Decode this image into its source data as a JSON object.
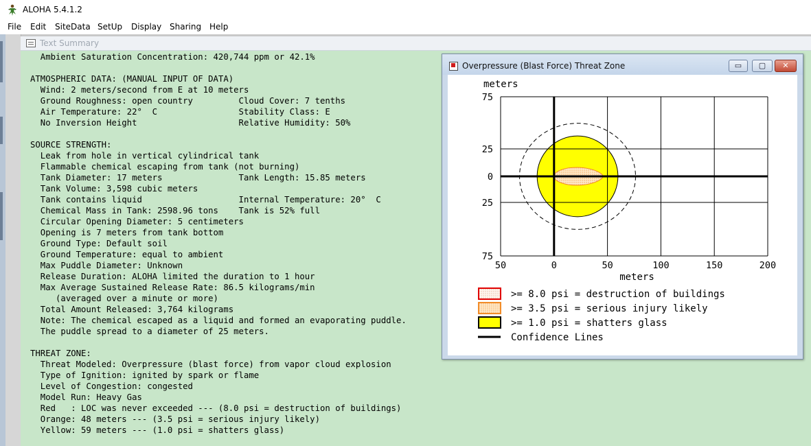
{
  "app": {
    "title": "ALOHA 5.4.1.2"
  },
  "menu": [
    "File",
    "Edit",
    "SiteData",
    "SetUp",
    "Display",
    "Sharing",
    "Help"
  ],
  "text_summary": {
    "title": "Text Summary",
    "lines": [
      "  Ambient Saturation Concentration: 420,744 ppm or 42.1%",
      "",
      "ATMOSPHERIC DATA: (MANUAL INPUT OF DATA)",
      "  Wind: 2 meters/second from E at 10 meters",
      "  Ground Roughness: open country         Cloud Cover: 7 tenths",
      "  Air Temperature: 22°  C                Stability Class: E",
      "  No Inversion Height                    Relative Humidity: 50%",
      "",
      "SOURCE STRENGTH:",
      "  Leak from hole in vertical cylindrical tank",
      "  Flammable chemical escaping from tank (not burning)",
      "  Tank Diameter: 17 meters               Tank Length: 15.85 meters",
      "  Tank Volume: 3,598 cubic meters",
      "  Tank contains liquid                   Internal Temperature: 20°  C",
      "  Chemical Mass in Tank: 2598.96 tons    Tank is 52% full",
      "  Circular Opening Diameter: 5 centimeters",
      "  Opening is 7 meters from tank bottom",
      "  Ground Type: Default soil",
      "  Ground Temperature: equal to ambient",
      "  Max Puddle Diameter: Unknown",
      "  Release Duration: ALOHA limited the duration to 1 hour",
      "  Max Average Sustained Release Rate: 86.5 kilograms/min",
      "     (averaged over a minute or more)",
      "  Total Amount Released: 3,764 kilograms",
      "  Note: The chemical escaped as a liquid and formed an evaporating puddle.",
      "  The puddle spread to a diameter of 25 meters.",
      "",
      "THREAT ZONE:",
      "  Threat Modeled: Overpressure (blast force) from vapor cloud explosion",
      "  Type of Ignition: ignited by spark or flame",
      "  Level of Congestion: congested",
      "  Model Run: Heavy Gas",
      "  Red   : LOC was never exceeded --- (8.0 psi = destruction of buildings)",
      "  Orange: 48 meters --- (3.5 psi = serious injury likely)",
      "  Yellow: 59 meters --- (1.0 psi = shatters glass)"
    ]
  },
  "threat_window": {
    "title": "Overpressure (Blast Force) Threat Zone",
    "buttons": {
      "minimize": "▭",
      "maximize": "▢",
      "close": "✕"
    }
  },
  "chart_data": {
    "type": "area",
    "y_unit_label": "meters",
    "xlabel": "meters",
    "x_ticks": [
      "50",
      "0",
      "50",
      "100",
      "150",
      "200"
    ],
    "y_ticks": [
      "75",
      "25",
      "0",
      "25",
      "75"
    ],
    "xlim": [
      -50,
      200
    ],
    "ylim": [
      -75,
      75
    ],
    "grid": true,
    "source_point": {
      "x": 0,
      "y": 0
    },
    "zones": [
      {
        "name": "yellow",
        "level_psi": 1.0,
        "distance_m": 59,
        "color": "#ffff00",
        "outline": "#000000",
        "legend": ">= 1.0 psi = shatters glass"
      },
      {
        "name": "orange",
        "level_psi": 3.5,
        "distance_m": 48,
        "color": "#ffdca8",
        "outline": "#f28c28",
        "legend": ">= 3.5 psi = serious injury likely"
      },
      {
        "name": "red",
        "level_psi": 8.0,
        "distance_m": null,
        "color": "#fff3e6",
        "outline": "#e00000",
        "legend": ">= 8.0 psi = destruction of buildings"
      }
    ],
    "confidence_lines": {
      "legend": "Confidence Lines",
      "color": "#000000"
    },
    "legend_order": [
      "red",
      "orange",
      "yellow",
      "confidence"
    ]
  }
}
